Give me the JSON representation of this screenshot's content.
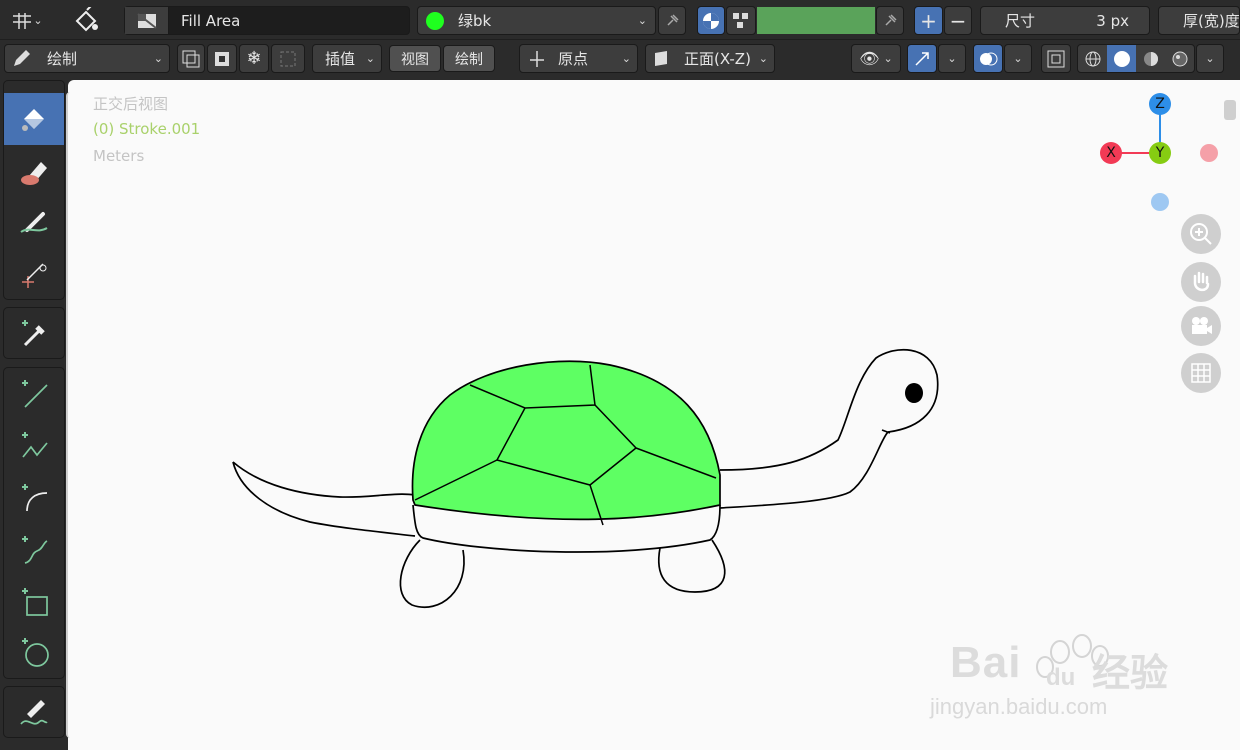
{
  "header": {
    "mode_icon": "gp-draw-mode-icon",
    "fill_icon": "fill-bucket-icon",
    "fill_mode_icon": "flag-icon",
    "fill_mode_label": "Fill Area",
    "material_swatch_color": "#1fff1f",
    "material_label": "绿bk",
    "pin_icon": "pin-icon",
    "color_mode_icon": "color-mode-icon",
    "vertex_color_icon": "vertex-color-icon",
    "active_color": "#5aa35a",
    "plus_label": "+",
    "minus_label": "−",
    "size_label": "尺寸",
    "size_value": "3 px",
    "thickness_label": "厚(宽)度"
  },
  "toolbar2": {
    "draw_mode_label": "绘制",
    "draw_mode_icon": "pencil-icon",
    "interpolate_label": "插值",
    "view_label": "视图",
    "draw_label": "绘制",
    "origin_label": "原点",
    "plane_label": "正面(X-Z)"
  },
  "viewport": {
    "view_name": "正交后视图",
    "object_name": "(0) Stroke.001",
    "units": "Meters",
    "turtle_shell_color": "#5eff63",
    "axis_x_label": "X",
    "axis_y_label": "Y",
    "axis_z_label": "Z",
    "axis_x_color": "#f23a55",
    "axis_y_color": "#86cc12",
    "axis_z_color": "#2d8ee8"
  },
  "tools": [
    "move-icon",
    "fill-bucket-icon",
    "eraser-icon",
    "tint-brush-icon",
    "cutter-icon",
    "eyedropper-icon",
    "line-icon",
    "polyline-icon",
    "arc-icon",
    "curve-icon",
    "box-icon",
    "circle-icon",
    "annotate-icon"
  ],
  "watermark": {
    "brand": "Bai",
    "brand2": "du",
    "cn": "经验",
    "url": "jingyan.baidu.com"
  }
}
